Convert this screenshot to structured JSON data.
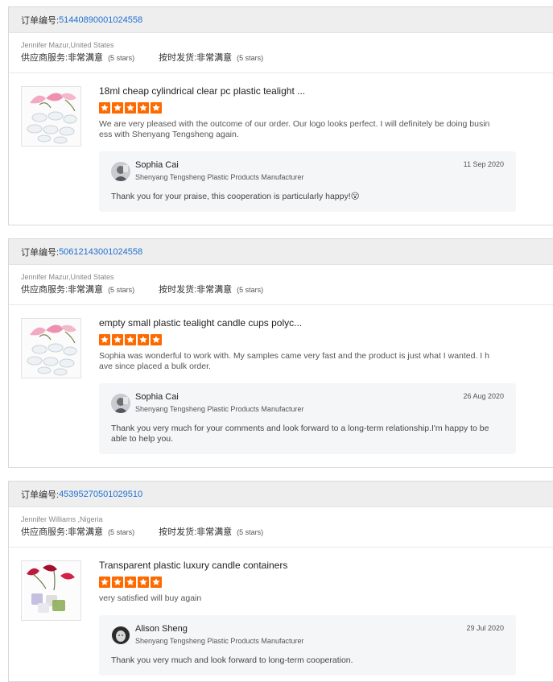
{
  "labels": {
    "order_no": "订单编号: ",
    "supplier_service": "供应商服务: ",
    "on_time_shipping": "按时发货: ",
    "very_satisfied": "非常满意",
    "five_stars": "(5 stars)"
  },
  "colors": {
    "star": "#ff6a00",
    "order_link": "#1f6fd1",
    "reply_bg": "#f5f6f8"
  },
  "reviews": [
    {
      "order_number": "51440890001024558",
      "buyer": "Jennifer Mazur,United States",
      "supplier_rating": 5,
      "shipping_rating": 5,
      "product_title": "18ml cheap cylindrical clear pc plastic tealight ...",
      "product_rating": 5,
      "text": "We are very pleased with the outcome of our order. Our logo looks perfect. I will definitely be doing business with Shenyang Tengsheng again.",
      "reply": {
        "name": "Sophia Cai",
        "company": "Shenyang Tengsheng Plastic Products Manufacturer",
        "date": "11 Sep 2020",
        "text": "Thank you for your praise, this cooperation is particularly happy!😮"
      }
    },
    {
      "order_number": "50612143001024558",
      "buyer": "Jennifer Mazur,United States",
      "supplier_rating": 5,
      "shipping_rating": 5,
      "product_title": "empty small plastic tealight candle cups polyc...",
      "product_rating": 5,
      "text": "Sophia was wonderful to work with. My samples came very fast and the product is just what I wanted. I have since placed a bulk order.",
      "reply": {
        "name": "Sophia Cai",
        "company": "Shenyang Tengsheng Plastic Products Manufacturer",
        "date": "26 Aug 2020",
        "text": "Thank you very much for your comments and look forward to a long-term relationship.I'm happy to be able to help you."
      }
    },
    {
      "order_number": "45395270501029510",
      "buyer": "Jennifer Williams ,Nigeria",
      "supplier_rating": 5,
      "shipping_rating": 5,
      "product_title": "Transparent plastic luxury candle containers",
      "product_rating": 5,
      "text": "very satisfied will buy again",
      "reply": {
        "name": "Alison Sheng",
        "company": "Shenyang Tengsheng Plastic Products Manufacturer",
        "date": "29 Jul 2020",
        "text": "Thank you very much and look forward to long-term cooperation."
      }
    }
  ]
}
